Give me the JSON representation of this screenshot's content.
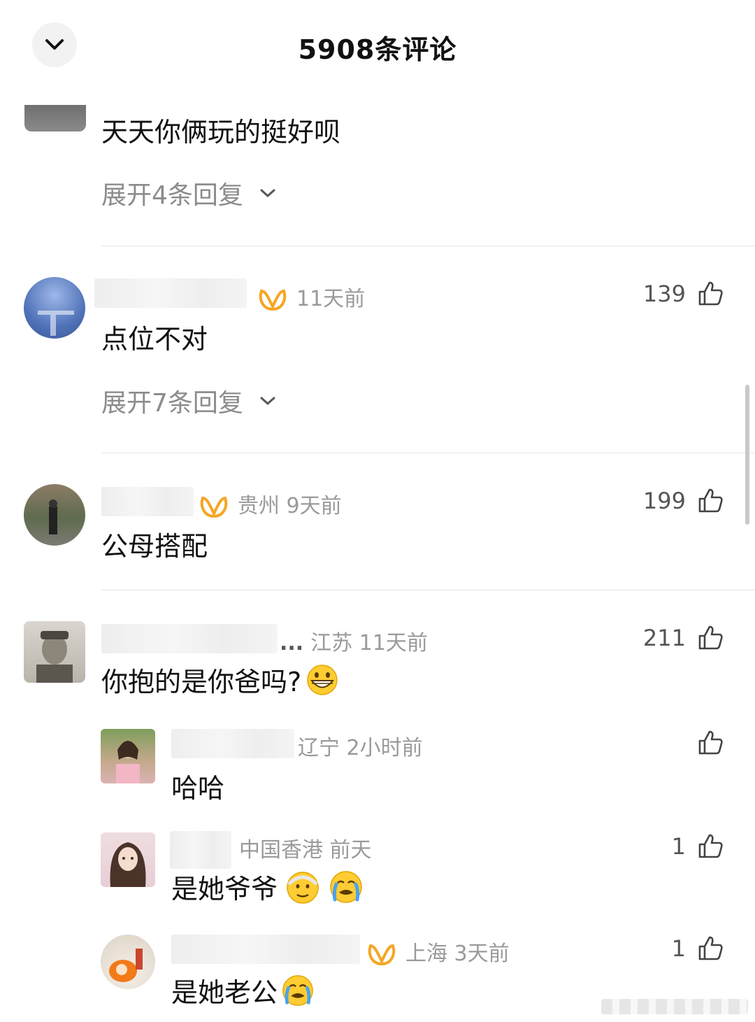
{
  "header": {
    "title": "5908条评论",
    "back_icon": "chevron-down-icon"
  },
  "comments": [
    {
      "text": "天天你俩玩的挺好呗",
      "expand_label": "展开4条回复"
    },
    {
      "meta": "11天前",
      "likes": "139",
      "text": "点位不对",
      "expand_label": "展开7条回复"
    },
    {
      "meta": "贵州 9天前",
      "likes": "199",
      "text": "公母搭配"
    },
    {
      "name_suffix": "...",
      "meta": "江苏 11天前",
      "likes": "211",
      "text": "你抱的是你爸吗?",
      "emoji": "grinning-face",
      "replies": [
        {
          "meta": "辽宁 2小时前",
          "likes": "",
          "text": "哈哈"
        },
        {
          "meta": "中国香港 前天",
          "likes": "1",
          "text": "是她爷爷",
          "emojis": [
            "older-man",
            "loudly-crying-face"
          ]
        },
        {
          "meta": "上海 3天前",
          "likes": "1",
          "text": "是她老公",
          "emojis": [
            "loudly-crying-face"
          ]
        }
      ]
    }
  ],
  "colors": {
    "badge": "#f5a623",
    "meta_text": "#9a9a9a",
    "divider": "#e6e6e6"
  }
}
